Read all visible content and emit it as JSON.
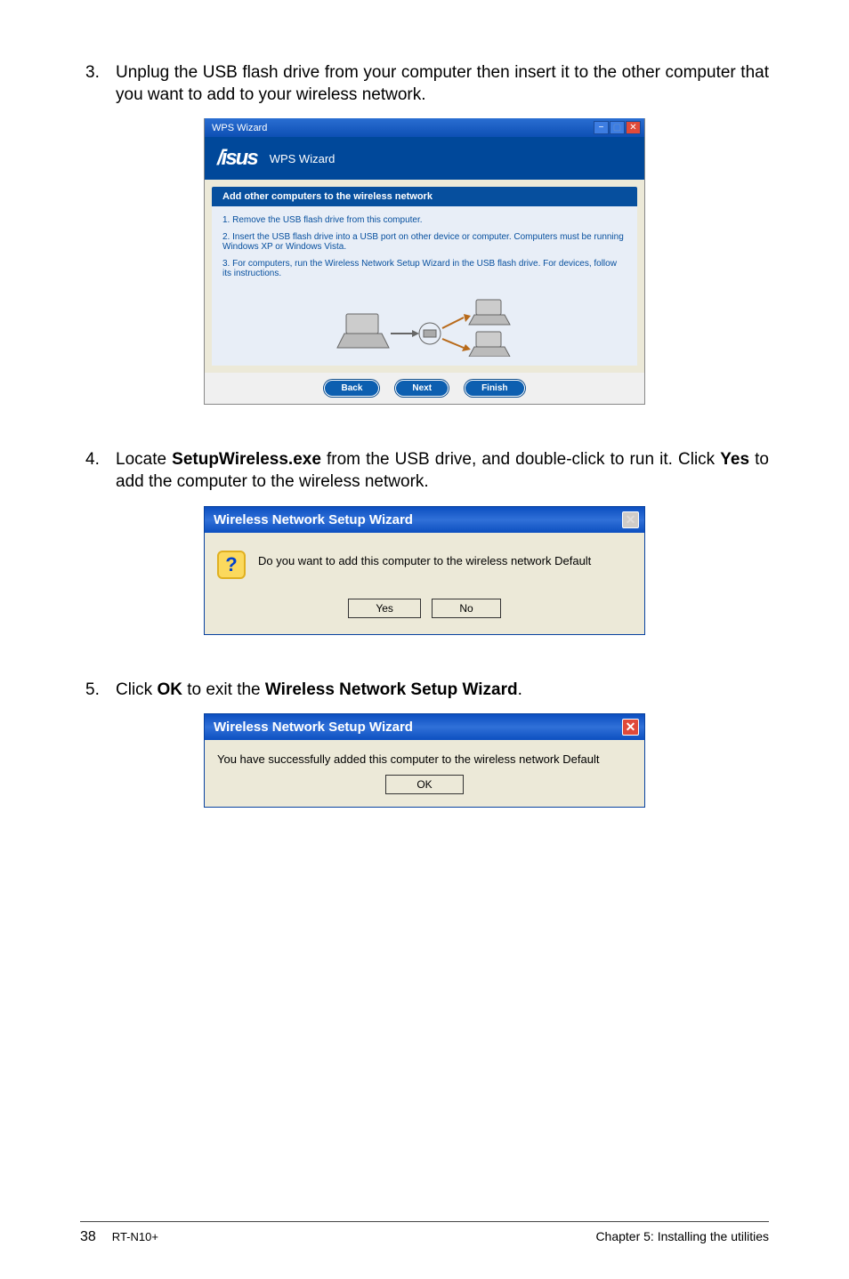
{
  "steps": {
    "s3_num": "3.",
    "s3_text_a": "Unplug the USB flash drive from your computer then insert it to the other computer that you want to add to your wireless network.",
    "s4_num": "4.",
    "s4_prefix": "Locate ",
    "s4_file": "SetupWireless.exe",
    "s4_mid": " from the USB drive, and double-click to run it. Click ",
    "s4_yes": "Yes",
    "s4_suffix": " to add the computer to the wireless network.",
    "s5_num": "5.",
    "s5_a": "Click ",
    "s5_ok": "OK",
    "s5_b": " to exit the ",
    "s5_wiz": "Wireless Network Setup Wizard",
    "s5_c": "."
  },
  "wps": {
    "win_title": "WPS Wizard",
    "app_logo": "/isus",
    "app_title": "WPS Wizard",
    "heading": "Add other computers to the wireless network",
    "line1": "1. Remove the USB flash drive from this computer.",
    "line2": "2. Insert the USB flash drive into a USB port on other device or computer. Computers must be running Windows XP or Windows Vista.",
    "line3": "3. For computers, run the Wireless Network Setup Wizard in the USB flash drive. For devices, follow its instructions.",
    "btn_back": "Back",
    "btn_next": "Next",
    "btn_finish": "Finish"
  },
  "dlg1": {
    "title": "Wireless Network Setup Wizard",
    "msg": "Do you want to add this computer to the wireless network Default",
    "yes": "Yes",
    "no": "No"
  },
  "dlg2": {
    "title": "Wireless Network Setup Wizard",
    "msg": "You have successfully added this computer to the wireless network Default",
    "ok": "OK"
  },
  "footer": {
    "page": "38",
    "model": "RT-N10+",
    "chapter": "Chapter 5: Installing the utilities"
  }
}
